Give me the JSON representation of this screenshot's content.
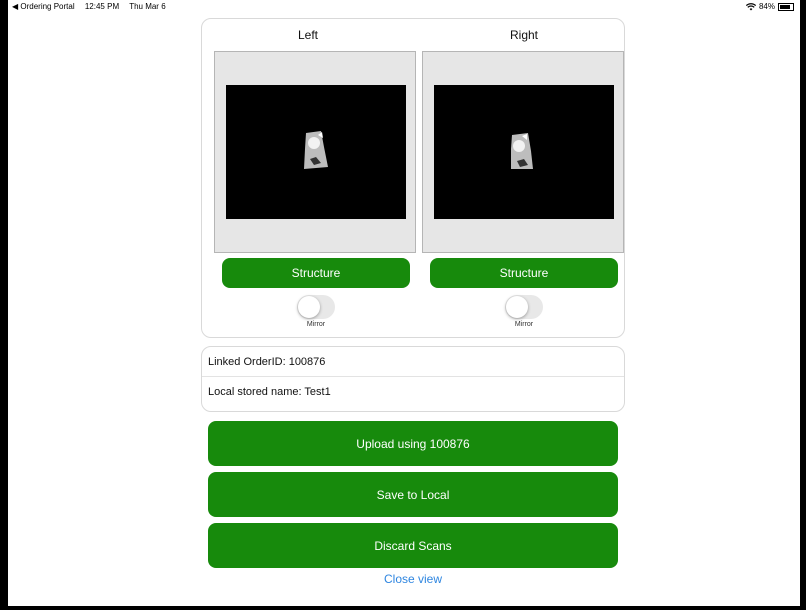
{
  "status_bar": {
    "back_app": "◀ Ordering Portal",
    "time": "12:45 PM",
    "date": "Thu Mar 6",
    "battery": "84%",
    "battery_level": 0.84
  },
  "scans": {
    "left": {
      "title": "Left",
      "structure_label": "Structure",
      "mirror_label": "Mirror",
      "mirror_on": false
    },
    "right": {
      "title": "Right",
      "structure_label": "Structure",
      "mirror_label": "Mirror",
      "mirror_on": false
    }
  },
  "info": {
    "linked_order": "Linked OrderID:  100876",
    "local_name": "Local stored name:  Test1"
  },
  "actions": {
    "upload": "Upload using 100876",
    "save": "Save to Local",
    "discard": "Discard Scans",
    "close": "Close view"
  },
  "colors": {
    "button_green": "#178a0c",
    "link_blue": "#2f86e0"
  }
}
